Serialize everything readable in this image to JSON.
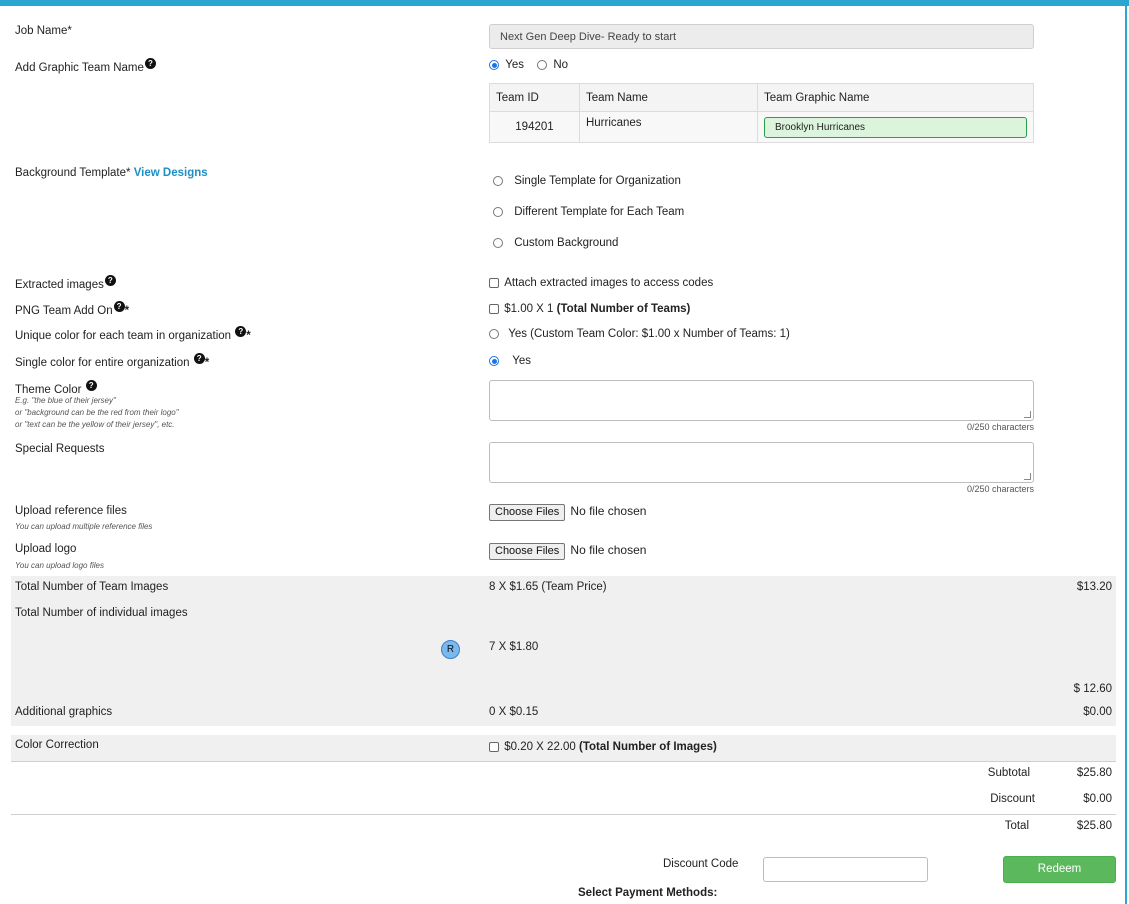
{
  "job_name": {
    "label": "Job Name*",
    "value": "Next Gen Deep Dive- Ready to start"
  },
  "graphic_team_name": {
    "label": "Add Graphic Team Name",
    "yes": "Yes",
    "no": "No"
  },
  "team_table": {
    "headers": [
      "Team ID",
      "Team Name",
      "Team Graphic Name"
    ],
    "rows": [
      {
        "team_id": "194201",
        "team_name": "Hurricanes",
        "graphic_name": "Brooklyn Hurricanes"
      }
    ]
  },
  "background_template": {
    "label": "Background Template*",
    "link": "View Designs",
    "options": [
      "Single Template for Organization",
      "Different Template for Each Team",
      "Custom Background"
    ]
  },
  "extracted_images": {
    "label": "Extracted images",
    "checkbox": "Attach extracted images to access codes"
  },
  "png_team_addon": {
    "label": "PNG Team Add On",
    "star": "*",
    "checkbox_prefix": "$1.00 X 1 ",
    "checkbox_bold": "(Total Number of Teams)"
  },
  "unique_color": {
    "label": "Unique color for each team in organization",
    "star": "*",
    "option": "Yes (Custom Team Color: $1.00 x Number of Teams: 1)"
  },
  "single_color": {
    "label": "Single color for entire organization",
    "star": "*",
    "option": "Yes"
  },
  "theme_color": {
    "label": "Theme Color",
    "hint1": "E.g. \"the blue of their jersey\"",
    "hint2": "or \"background can be the red from their logo\"",
    "hint3": "or \"text can be the yellow of their jersey\", etc.",
    "counter": "0/250 characters"
  },
  "special_requests": {
    "label": "Special Requests",
    "counter": "0/250 characters"
  },
  "upload_reference": {
    "label": "Upload reference files",
    "hint": "You can upload multiple reference files",
    "button": "Choose Files",
    "status": "No file chosen"
  },
  "upload_logo": {
    "label": "Upload logo",
    "hint": "You can upload logo files",
    "button": "Choose Files",
    "status": "No file chosen"
  },
  "pricing": {
    "team_images": {
      "label": "Total Number of Team Images",
      "calc": "8 X $1.65 (Team Price)",
      "amount": "$13.20"
    },
    "individual_images": {
      "label": "Total Number of individual images",
      "badge": "R",
      "calc": "7 X $1.80",
      "amount": "$ 12.60"
    },
    "additional_graphics": {
      "label": "Additional graphics",
      "calc": "0 X $0.15",
      "amount": "$0.00"
    },
    "color_correction": {
      "label": "Color Correction",
      "calc_prefix": "$0.20 X 22.00 ",
      "calc_bold": "(Total Number of Images)"
    }
  },
  "totals": {
    "subtotal_label": "Subtotal",
    "subtotal": "$25.80",
    "discount_label": "Discount",
    "discount": "$0.00",
    "total_label": "Total",
    "total": "$25.80"
  },
  "discount_code": {
    "label": "Discount Code",
    "placeholder": "",
    "button": "Redeem"
  },
  "payment": {
    "label": "Select Payment Methods:"
  },
  "colors": {
    "accent": "#2ba6d0",
    "link": "#1b8fc6",
    "redeem": "#5cb85c",
    "graphic_input_bg": "#dcf3dc"
  }
}
